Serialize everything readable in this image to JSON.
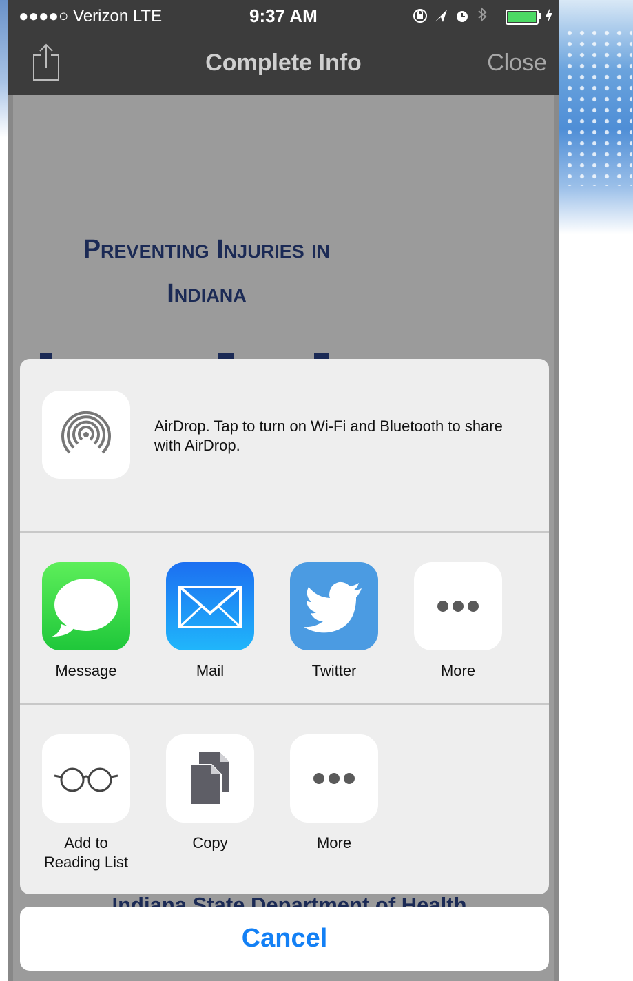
{
  "status_bar": {
    "carrier": "●●●●○ Verizon  LTE",
    "time": "9:37 AM",
    "battery_level": 1.0,
    "charging_icon": "bolt-icon"
  },
  "nav_bar": {
    "title": "Complete Info",
    "close_label": "Close"
  },
  "document": {
    "title_line1": "Preventing Injuries in",
    "title_line2": "Indiana",
    "footer_partial": "Indiana State Department of Health"
  },
  "share_sheet": {
    "airdrop": {
      "bold": "AirDrop",
      "text": ". Tap to turn on Wi-Fi and Bluetooth to share with AirDrop."
    },
    "share_apps": [
      {
        "label": "Message",
        "icon": "message-icon"
      },
      {
        "label": "Mail",
        "icon": "mail-icon"
      },
      {
        "label": "Twitter",
        "icon": "twitter-icon"
      },
      {
        "label": "More",
        "icon": "more-icon"
      }
    ],
    "actions": [
      {
        "label": "Add to\nReading List",
        "icon": "glasses-icon"
      },
      {
        "label": "Copy",
        "icon": "copy-icon"
      },
      {
        "label": "More",
        "icon": "more-icon"
      }
    ],
    "cancel_label": "Cancel"
  },
  "colors": {
    "accent": "#1380f5",
    "nav_bg": "#3c3c3c",
    "doc_title": "#1b2a55"
  }
}
